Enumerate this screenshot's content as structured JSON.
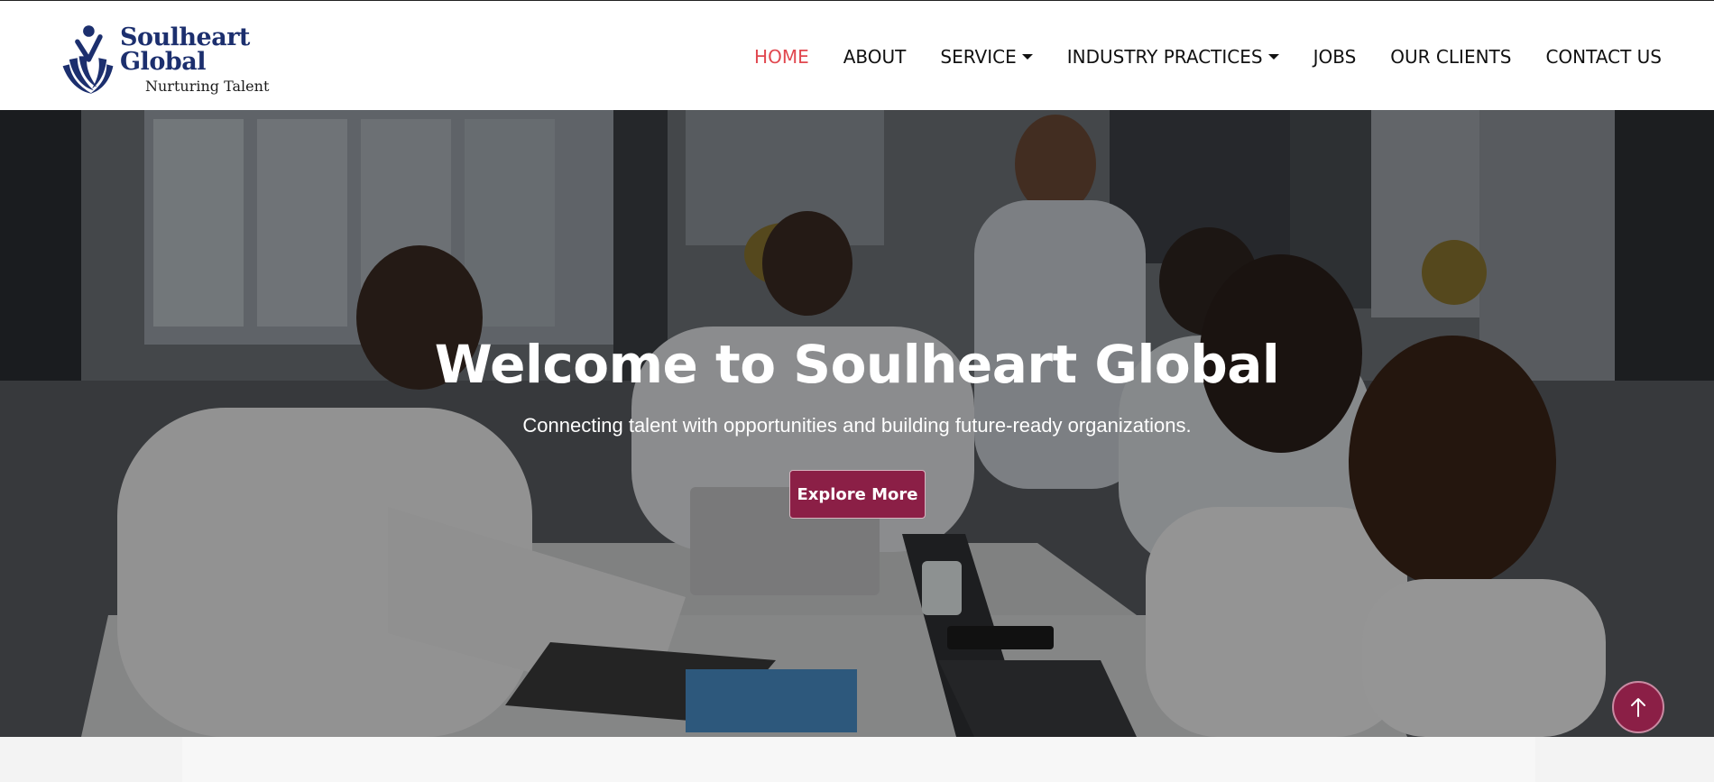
{
  "brand": {
    "name": "Soulheart Global",
    "tagline": "Nurturing Talent",
    "logo_icon": "person-leaves-icon",
    "color": "#1c2f6e"
  },
  "nav": {
    "items": [
      {
        "label": "HOME",
        "active": true,
        "dropdown": false
      },
      {
        "label": "ABOUT",
        "active": false,
        "dropdown": false
      },
      {
        "label": "SERVICE",
        "active": false,
        "dropdown": true
      },
      {
        "label": "INDUSTRY PRACTICES",
        "active": false,
        "dropdown": true
      },
      {
        "label": "JOBS",
        "active": false,
        "dropdown": false
      },
      {
        "label": "OUR CLIENTS",
        "active": false,
        "dropdown": false
      },
      {
        "label": "CONTACT US",
        "active": false,
        "dropdown": false
      }
    ],
    "active_color": "#e1474f"
  },
  "hero": {
    "title": "Welcome to Soulheart Global",
    "subtitle": "Connecting talent with opportunities and building future-ready organizations.",
    "button_label": "Explore More",
    "accent": "#8b1f46",
    "background_icon": "office-team-meeting-photo"
  },
  "scroll_top": {
    "icon": "arrow-up-icon"
  }
}
